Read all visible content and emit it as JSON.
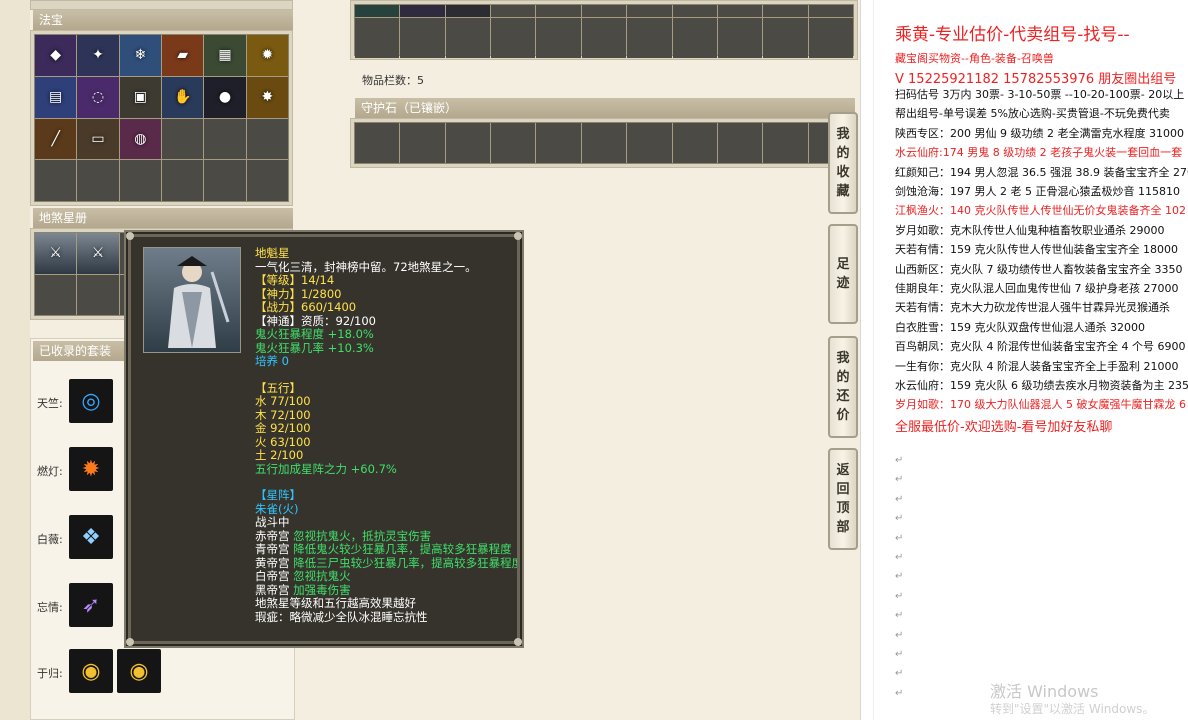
{
  "sections": {
    "fabao": "法宝",
    "disha": "地煞星册",
    "sets": "已收录的套装",
    "guardian": "守护石（已镶嵌）"
  },
  "inventory_count": "物品栏数：5",
  "fabao_items": [
    "purple-gem-icon",
    "sword-icon",
    "ice-blade-icon",
    "fire-brick-icon",
    "green-cube-icon",
    "gold-flame-icon",
    "blue-book-icon",
    "purple-ring-icon",
    "bronze-plate-icon",
    "ghost-hand-icon",
    "dark-orb-icon",
    "gold-seal-icon",
    "spear-icon",
    "scroll-icon",
    "lantern-icon"
  ],
  "set_rows": [
    {
      "label": "天竺:",
      "icon": "blue-ring-icon"
    },
    {
      "label": "燃灯:",
      "icon": "fire-emblem-icon"
    },
    {
      "label": "白薇:",
      "icon": "ice-crown-icon"
    },
    {
      "label": "忘情:",
      "icon": "purple-blade-icon"
    },
    {
      "label": "于归:",
      "icon": "gold-ring-icon"
    }
  ],
  "tooltip": {
    "portrait": "warrior-portrait",
    "name": "地魁星",
    "desc": "一气化三清，封神榜中留。72地煞星之一。",
    "stats": [
      "【等级】14/14",
      "【神力】1/2800",
      "【战力】660/1400",
      "【神通】资质：92/100"
    ],
    "bonus": [
      "鬼火狂暴程度 +18.0%",
      "鬼火狂暴几率 +10.3%"
    ],
    "peiyang": "培养 0",
    "wuxing_head": "【五行】",
    "wuxing": [
      "水 77/100",
      "木 72/100",
      "金 92/100",
      "火 63/100",
      "土 2/100"
    ],
    "wuxing_bonus": "五行加成星阵之力 +60.7%",
    "xingzhen_head": "【星阵】",
    "xingzhen_name": "朱雀(火)",
    "in_battle": "战斗中",
    "palaces": [
      {
        "name": "赤帝宫",
        "effect": "忽视抗鬼火，抵抗灵宝伤害"
      },
      {
        "name": "青帝宫",
        "effect": "降低鬼火较少狂暴几率，提高较多狂暴程度"
      },
      {
        "name": "黄帝宫",
        "effect": "降低三尸虫较少狂暴几率，提高较多狂暴程度"
      },
      {
        "name": "白帝宫",
        "effect": "忽视抗鬼火"
      },
      {
        "name": "黑帝宫",
        "effect": "加强毒伤害"
      }
    ],
    "note": "地煞星等级和五行越高效果越好",
    "flaw": "瑕疵：略微减少全队冰混睡忘抗性"
  },
  "side_tabs": [
    {
      "label": "我的收藏"
    },
    {
      "label": "足迹"
    },
    {
      "label": "我的还价"
    },
    {
      "label": "返回顶部"
    }
  ],
  "doc": {
    "title": "乘黄-专业估价-代卖组号-找号--",
    "lines": [
      {
        "text": "藏宝阁买物资--角色-装备-召唤兽",
        "red": true
      },
      {
        "text": "V 15225921182   15782553976 朋友圈出组号",
        "red": true,
        "big": true
      },
      {
        "text": "扫码估号 3万内 30票- 3-10-50票  --10-20-100票- 20以上 1",
        "red": false
      },
      {
        "text": "帮出组号-单号误差 5%放心选购-买贵管退-不玩免费代卖",
        "red": false
      },
      {
        "text": "陕西专区：200 男仙 9 级功绩 2 老全满雷克水程度 31000",
        "red": false
      },
      {
        "text": "水云仙府:174 男鬼 8 级功绩 2 老孩子鬼火装一套回血一套",
        "red": true
      },
      {
        "text": "红颜知己：194 男人忽混 36.5 强混 38.9 装备宝宝齐全 2700",
        "red": false
      },
      {
        "text": "剑蚀沧海：197 男人 2 老 5 正骨混心猿孟极炒音 115810",
        "red": false
      },
      {
        "text": "江枫渔火：140 克火队传世人传世仙无价女鬼装备齐全 102",
        "red": true
      },
      {
        "text": "岁月如歌：克木队传世人仙鬼种植畜牧职业通杀 29000",
        "red": false
      },
      {
        "text": "天若有情：159 克火队传世人传世仙装备宝宝齐全 18000",
        "red": false
      },
      {
        "text": "山西新区：克火队 7 级功绩传世人畜牧装备宝宝齐全 3350",
        "red": false
      },
      {
        "text": "佳期良年：克火队混人回血鬼传世仙 7 级护身老孩 27000",
        "red": false
      },
      {
        "text": "天若有情：克木大力砍龙传世混人强牛甘霖异光灵猴通杀",
        "red": false
      },
      {
        "text": "白衣胜雪：159 克火队双盘传世仙混人通杀 32000",
        "red": false
      },
      {
        "text": "百鸟朝凤：克火队 4 阶混传世仙装备宝宝齐全 4 个号 6900",
        "red": false
      },
      {
        "text": "一生有你：克火队 4 阶混人装备宝宝齐全上手盈利 21000",
        "red": false
      },
      {
        "text": "水云仙府：159 克火队 6 级功绩去疾水月物资装备为主 235",
        "red": false
      },
      {
        "text": "岁月如歌：170 级大力队仙器混人 5 破女魔强牛魔甘霖龙 6",
        "red": true
      },
      {
        "text": "全服最低价-欢迎选购-看号加好友私聊",
        "red": true,
        "big": true
      }
    ],
    "para_mark": "↵"
  },
  "watermark": {
    "line1": "激活 Windows",
    "line2": "转到\"设置\"以激活 Windows。"
  }
}
